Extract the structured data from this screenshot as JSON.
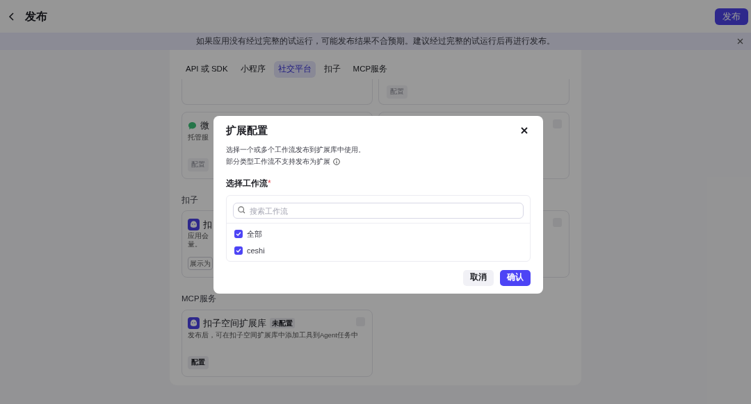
{
  "header": {
    "title": "发布",
    "publish_button": "发布"
  },
  "banner": {
    "text": "如果应用没有经过完整的试运行，可能发布结果不合预期。建议经过完整的试运行后再进行发布。"
  },
  "tabs": [
    {
      "label": "API 或 SDK",
      "selected": false
    },
    {
      "label": "小程序",
      "selected": false
    },
    {
      "label": "社交平台",
      "selected": true
    },
    {
      "label": "扣子",
      "selected": false
    },
    {
      "label": "MCP服务",
      "selected": false
    }
  ],
  "sections": [
    {
      "kind": "scrolled",
      "cards": [
        {
          "kind": "plain"
        },
        {
          "kind": "plain",
          "button": "配置"
        }
      ]
    },
    {
      "kind": "full",
      "cards": [
        {
          "kind": "social",
          "title": "微",
          "desc": [
            "托管服"
          ],
          "button": "配置"
        },
        {
          "kind": "plain",
          "checked": false
        }
      ]
    },
    {
      "kind": "full",
      "label": "扣子",
      "cards": [
        {
          "kind": "coze",
          "title": "扣",
          "desc": [
            "应用会",
            "量。"
          ],
          "button": "展示为"
        },
        {
          "kind": "plain",
          "checked": false
        }
      ]
    },
    {
      "kind": "full",
      "label": "MCP服务",
      "cards": [
        {
          "kind": "mcp",
          "title": "扣子空间扩展库",
          "badge": "未配置",
          "desc": [
            "发布后，可在扣子空间扩展库中添加工具到Agent任务中"
          ],
          "button": "配置",
          "checked": false
        }
      ]
    }
  ],
  "modal": {
    "title": "扩展配置",
    "notes": [
      {
        "text": "选择一个或多个工作流发布到扩展库中使用。",
        "info": false
      },
      {
        "text": "部分类型工作流不支持发布为扩展",
        "info": true
      }
    ],
    "field_label": "选择工作流",
    "required_mark": "*",
    "search": {
      "placeholder": "搜索工作流"
    },
    "options": [
      {
        "label": "全部",
        "checked": true
      },
      {
        "label": "ceshi",
        "checked": true
      }
    ],
    "cancel_button": "取消",
    "confirm_button": "确认"
  }
}
